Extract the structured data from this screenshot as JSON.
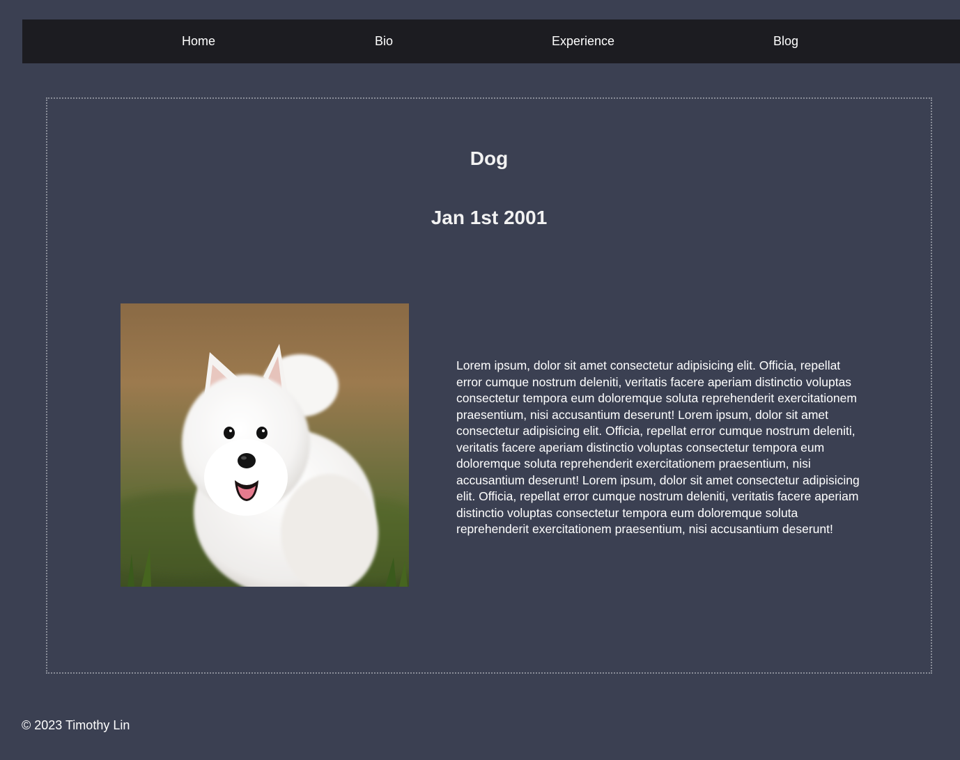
{
  "nav": {
    "items": [
      {
        "label": "Home"
      },
      {
        "label": "Bio"
      },
      {
        "label": "Experience"
      },
      {
        "label": "Blog"
      }
    ]
  },
  "post": {
    "title": "Dog",
    "date": "Jan 1st 2001",
    "image_subject": "white fluffy puppy photo",
    "body": "Lorem ipsum, dolor sit amet consectetur adipisicing elit. Officia, repellat error cumque nostrum deleniti, veritatis facere aperiam distinctio voluptas consectetur tempora eum doloremque soluta reprehenderit exercitationem praesentium, nisi accusantium deserunt! Lorem ipsum, dolor sit amet consectetur adipisicing elit. Officia, repellat error cumque nostrum deleniti, veritatis facere aperiam distinctio voluptas consectetur tempora eum doloremque soluta reprehenderit exercitationem praesentium, nisi accusantium deserunt! Lorem ipsum, dolor sit amet consectetur adipisicing elit. Officia, repellat error cumque nostrum deleniti, veritatis facere aperiam distinctio voluptas consectetur tempora eum doloremque soluta reprehenderit exercitationem praesentium, nisi accusantium deserunt!"
  },
  "footer": {
    "copyright": "© 2023 Timothy Lin"
  },
  "colors": {
    "page_background": "#3b4052",
    "navbar_background": "#1c1c21",
    "card_border": "#8a8e99",
    "text": "#ffffff"
  }
}
